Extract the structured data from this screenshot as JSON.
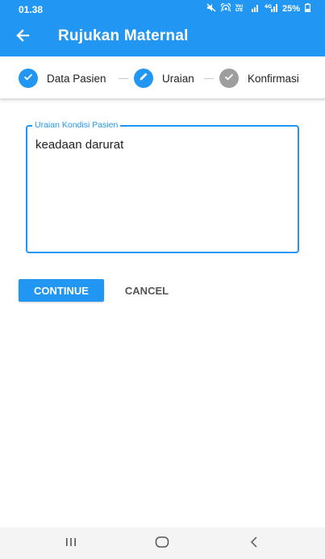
{
  "status_bar": {
    "time": "01.38",
    "battery": "25%",
    "icons": [
      "mute-icon",
      "hotspot-icon",
      "volte-icon",
      "signal-icon",
      "4g-signal-icon",
      "battery-icon"
    ]
  },
  "app_bar": {
    "title": "Rujukan Maternal",
    "back_icon": "arrow-left-icon"
  },
  "stepper": {
    "steps": [
      {
        "label": "Data Pasien",
        "state": "completed",
        "icon": "check-icon"
      },
      {
        "label": "Uraian",
        "state": "editing",
        "icon": "pencil-icon"
      },
      {
        "label": "Konfirmasi",
        "state": "inactive",
        "icon": "check-icon"
      }
    ]
  },
  "form": {
    "field_label": "Uraian Kondisi Pasien",
    "field_value": "keadaan darurat"
  },
  "actions": {
    "continue_label": "CONTINUE",
    "cancel_label": "CANCEL"
  },
  "colors": {
    "primary": "#2196f3",
    "inactive": "#9e9e9e"
  }
}
